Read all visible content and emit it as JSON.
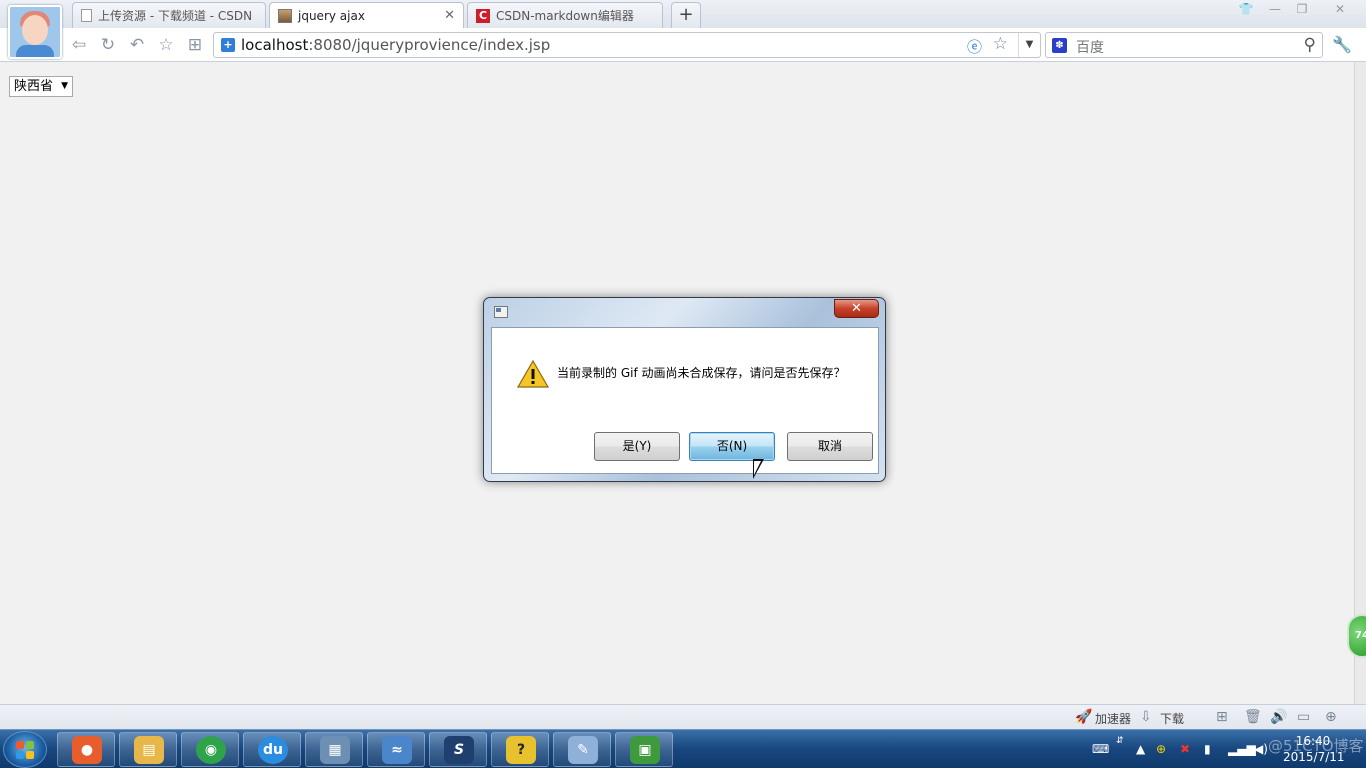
{
  "browser": {
    "tabs": [
      {
        "title": "上传资源 - 下载频道 - CSDN",
        "icon": "page-icon",
        "active": false
      },
      {
        "title": "jquery ajax",
        "icon": "image-icon",
        "active": true
      },
      {
        "title": "CSDN-markdown编辑器",
        "icon": "csdn-logo-icon",
        "active": false
      }
    ],
    "new_tab": "+",
    "close_tab": "✕",
    "address": {
      "host": "localhost",
      "rest": ":8080/jqueryprovience/index.jsp"
    },
    "search_placeholder": "百度"
  },
  "page": {
    "province_select": "陕西省"
  },
  "dialog": {
    "message": "当前录制的 Gif 动画尚未合成保存，请问是否先保存？",
    "buttons": {
      "yes": "是(Y)",
      "no": "否(N)",
      "cancel": "取消"
    },
    "close": "✕"
  },
  "statusbar": {
    "accelerator": "加速器",
    "download": "下载"
  },
  "floating_badge": "74",
  "taskbar": {
    "apps": [
      {
        "name": "taskbar-app-color-icon",
        "glyph": "●",
        "color": "#e85d2c"
      },
      {
        "name": "taskbar-app-explorer-icon",
        "glyph": "▤",
        "color": "#e8b74a"
      },
      {
        "name": "taskbar-app-browser-icon",
        "glyph": "◉",
        "color": "#2fa34b"
      },
      {
        "name": "taskbar-app-baidu-icon",
        "glyph": "du",
        "color": "#2b8de0"
      },
      {
        "name": "taskbar-app-control-icon",
        "glyph": "▦",
        "color": "#6d8fb4"
      },
      {
        "name": "taskbar-app-dolphin-icon",
        "glyph": "≈",
        "color": "#4a86c9"
      },
      {
        "name": "taskbar-app-s-icon",
        "glyph": "S",
        "color": "#1f3f6e"
      },
      {
        "name": "taskbar-app-help-icon",
        "glyph": "?",
        "color": "#e8c22e"
      },
      {
        "name": "taskbar-app-paint-icon",
        "glyph": "✎",
        "color": "#8fb0d8"
      },
      {
        "name": "taskbar-app-image-icon",
        "glyph": "▣",
        "color": "#3e9a3c"
      }
    ],
    "clock_time": "16:40",
    "clock_date": "2015/7/11"
  },
  "watermark": "@51CTO博客"
}
